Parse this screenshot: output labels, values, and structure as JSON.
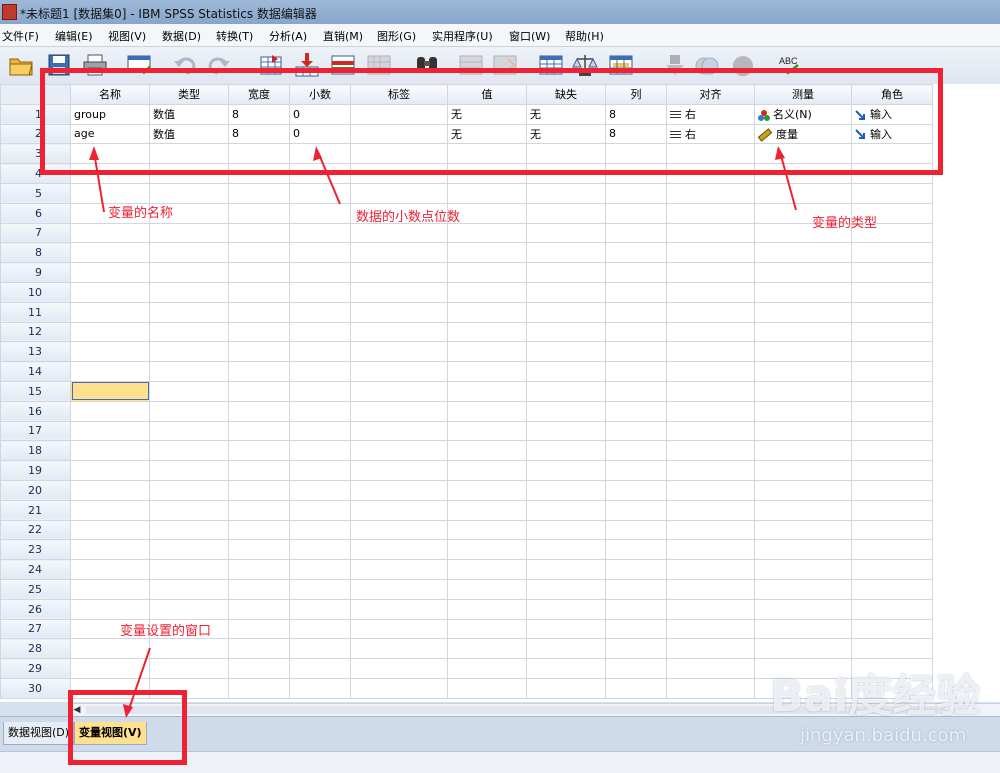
{
  "window": {
    "title": "*未标题1 [数据集0] - IBM SPSS Statistics 数据编辑器"
  },
  "menu": [
    "文件(F)",
    "编辑(E)",
    "视图(V)",
    "数据(D)",
    "转换(T)",
    "分析(A)",
    "直销(M)",
    "图形(G)",
    "实用程序(U)",
    "窗口(W)",
    "帮助(H)"
  ],
  "toolbar": {
    "icons": [
      "open-icon",
      "save-icon",
      "print-icon",
      "recall-dialog-icon",
      "undo-icon",
      "redo-icon",
      "goto-case-icon",
      "goto-variable-icon",
      "variables-icon",
      "run-descriptives-icon",
      "find-icon",
      "insert-cases-icon",
      "insert-variable-icon",
      "split-file-icon",
      "weight-cases-icon",
      "select-cases-icon",
      "value-labels-icon",
      "use-sets-icon",
      "show-all-icon",
      "spell-check-icon"
    ],
    "spell_label": "ABC"
  },
  "grid": {
    "columns": [
      "名称",
      "类型",
      "宽度",
      "小数",
      "标签",
      "值",
      "缺失",
      "列",
      "对齐",
      "测量",
      "角色"
    ],
    "rows": [
      {
        "num": "1",
        "name": "group",
        "type": "数值",
        "width": "8",
        "decimals": "0",
        "label": "",
        "values": "无",
        "missing": "无",
        "columns": "8",
        "align": "右",
        "measure": "名义(N)",
        "role": "输入"
      },
      {
        "num": "2",
        "name": "age",
        "type": "数值",
        "width": "8",
        "decimals": "0",
        "label": "",
        "values": "无",
        "missing": "无",
        "columns": "8",
        "align": "右",
        "measure": "度量",
        "role": "输入"
      }
    ],
    "row_numbers": [
      "3",
      "4",
      "5",
      "6",
      "7",
      "8",
      "9",
      "10",
      "11",
      "12",
      "13",
      "14",
      "15",
      "16",
      "17",
      "18",
      "19",
      "20",
      "21",
      "22",
      "23",
      "24",
      "25",
      "26",
      "27",
      "28",
      "29",
      "30"
    ],
    "selected_row": "15"
  },
  "tabs": {
    "data_view": "数据视图(D)",
    "variable_view": "变量视图(V)"
  },
  "annotations": {
    "name_note": "变量的名称",
    "decimals_note": "数据的小数点位数",
    "type_note": "变量的类型",
    "window_note": "变量设置的窗口",
    "color": "#ee2233"
  },
  "watermark": {
    "brand": "Bai度经验",
    "url": "jingyan.baidu.com"
  }
}
